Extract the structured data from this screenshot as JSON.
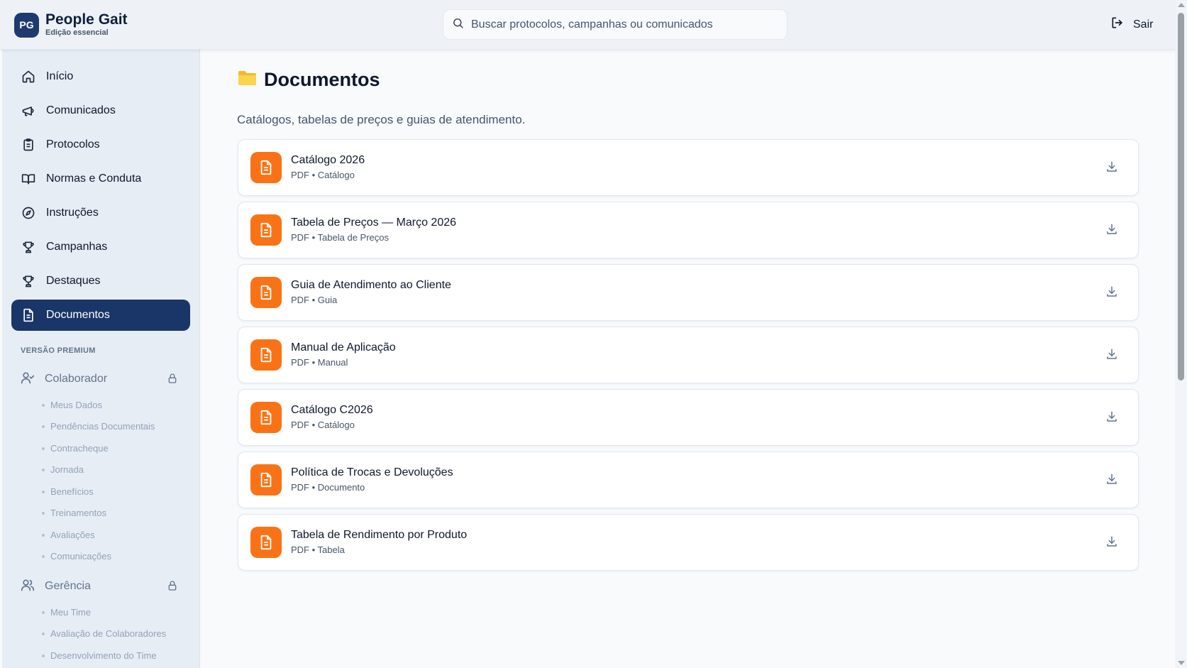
{
  "brand": {
    "logo": "PG",
    "name": "People Gait",
    "subtitle": "Edição essencial"
  },
  "search": {
    "placeholder": "Buscar protocolos, campanhas ou comunicados",
    "value": ""
  },
  "header": {
    "logout_label": "Sair"
  },
  "sidebar": {
    "items": [
      {
        "label": "Início",
        "icon": "home-icon"
      },
      {
        "label": "Comunicados",
        "icon": "megaphone-icon"
      },
      {
        "label": "Protocolos",
        "icon": "clipboard-icon"
      },
      {
        "label": "Normas e Conduta",
        "icon": "book-icon"
      },
      {
        "label": "Instruções",
        "icon": "compass-icon"
      },
      {
        "label": "Campanhas",
        "icon": "trophy-icon"
      },
      {
        "label": "Destaques",
        "icon": "trophy-icon"
      },
      {
        "label": "Documentos",
        "icon": "document-icon",
        "active": true
      }
    ],
    "premium_label": "VERSÃO PREMIUM",
    "premium_groups": [
      {
        "label": "Colaborador",
        "icon": "user-check-icon",
        "subitems": [
          "Meus Dados",
          "Pendências Documentais",
          "Contracheque",
          "Jornada",
          "Benefícios",
          "Treinamentos",
          "Avaliações",
          "Comunicações"
        ]
      },
      {
        "label": "Gerência",
        "icon": "users-icon",
        "subitems": [
          "Meu Time",
          "Avaliação de Colaboradores",
          "Desenvolvimento do Time"
        ]
      }
    ]
  },
  "main": {
    "title": "Documentos",
    "description": "Catálogos, tabelas de preços e guias de atendimento.",
    "documents": [
      {
        "title": "Catálogo 2026",
        "format": "PDF",
        "category": "Catálogo"
      },
      {
        "title": "Tabela de Preços — Março 2026",
        "format": "PDF",
        "category": "Tabela de Preços"
      },
      {
        "title": "Guia de Atendimento ao Cliente",
        "format": "PDF",
        "category": "Guia"
      },
      {
        "title": "Manual de Aplicação",
        "format": "PDF",
        "category": "Manual"
      },
      {
        "title": "Catálogo C2026",
        "format": "PDF",
        "category": "Catálogo"
      },
      {
        "title": "Política de Trocas e Devoluções",
        "format": "PDF",
        "category": "Documento"
      },
      {
        "title": "Tabela de Rendimento por Produto",
        "format": "PDF",
        "category": "Tabela"
      }
    ]
  },
  "colors": {
    "brand_navy": "#1a3668",
    "doc_orange": "#f97316",
    "sidebar_bg": "#e6edf5"
  }
}
